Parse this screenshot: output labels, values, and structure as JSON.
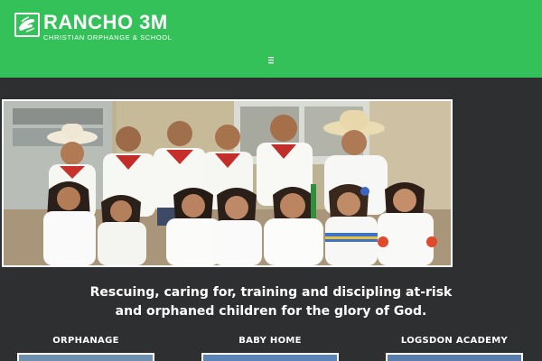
{
  "site": {
    "logo_title": "RANCHO 3M",
    "logo_subtitle": "CHRISTIAN ORPHANGE & SCHOOL"
  },
  "nav": {
    "menu_icon": "hamburger-menu-icon"
  },
  "hero": {
    "image": "group photo of children in white shirts and red bandanas"
  },
  "tagline": {
    "line1": "Rescuing, caring for, training and discipling at-risk",
    "line2": "and orphaned children for the glory of God."
  },
  "sections": [
    {
      "title": "ORPHANAGE"
    },
    {
      "title": "BABY HOME"
    },
    {
      "title": "LOGSDON ACADEMY"
    }
  ],
  "colors": {
    "header_green": "#35c159",
    "page_background": "#2e2f31",
    "text": "#ffffff"
  }
}
